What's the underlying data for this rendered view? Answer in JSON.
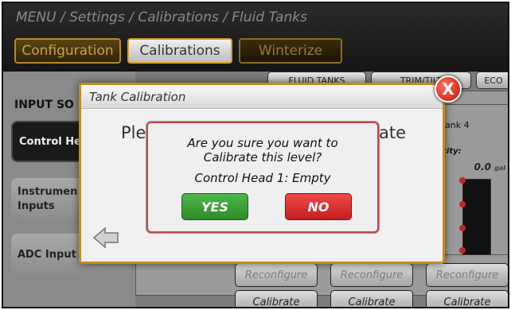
{
  "breadcrumb": "MENU / Settings / Calibrations / Fluid Tanks",
  "tabs": [
    {
      "label": "Configuration"
    },
    {
      "label": "Calibrations"
    },
    {
      "label": "Winterize"
    }
  ],
  "left_nav": {
    "heading": "INPUT SO",
    "items": [
      {
        "label": "Control He"
      },
      {
        "label": "Instrumen\nInputs"
      },
      {
        "label": "ADC Input"
      }
    ]
  },
  "subtabs": [
    {
      "label": "FLUID TANKS"
    },
    {
      "label": "TRIM/TILT"
    },
    {
      "label": "ECO"
    }
  ],
  "tank": {
    "label": "ank 4",
    "capacity_label": "city:",
    "capacity_value": "0.0",
    "capacity_unit": "gal"
  },
  "buttons": {
    "reconfigure": "Reconfigure",
    "calibrate": "Calibrate"
  },
  "dialog": {
    "title": "Tank Calibration",
    "close_glyph": "X",
    "background_left": "Ple",
    "background_right": "ate"
  },
  "confirm": {
    "question": "Are you sure you want to Calibrate this level?",
    "detail": "Control Head 1: Empty",
    "yes": "YES",
    "no": "NO"
  },
  "colors": {
    "accent_gold": "#c78a1a",
    "yes_green": "#3ea13a",
    "no_red": "#d92d2d",
    "level_dot": "#c0252b"
  }
}
